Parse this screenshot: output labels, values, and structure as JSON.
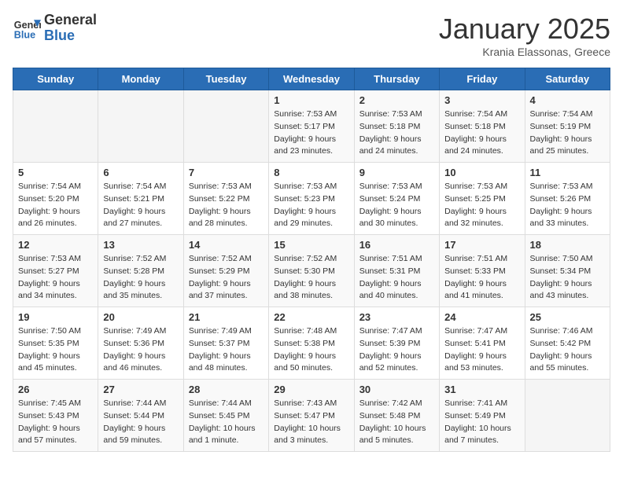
{
  "header": {
    "logo_general": "General",
    "logo_blue": "Blue",
    "month_title": "January 2025",
    "subtitle": "Krania Elassonas, Greece"
  },
  "weekdays": [
    "Sunday",
    "Monday",
    "Tuesday",
    "Wednesday",
    "Thursday",
    "Friday",
    "Saturday"
  ],
  "weeks": [
    [
      {
        "day": "",
        "sunrise": "",
        "sunset": "",
        "daylight": ""
      },
      {
        "day": "",
        "sunrise": "",
        "sunset": "",
        "daylight": ""
      },
      {
        "day": "",
        "sunrise": "",
        "sunset": "",
        "daylight": ""
      },
      {
        "day": "1",
        "sunrise": "Sunrise: 7:53 AM",
        "sunset": "Sunset: 5:17 PM",
        "daylight": "Daylight: 9 hours and 23 minutes."
      },
      {
        "day": "2",
        "sunrise": "Sunrise: 7:53 AM",
        "sunset": "Sunset: 5:18 PM",
        "daylight": "Daylight: 9 hours and 24 minutes."
      },
      {
        "day": "3",
        "sunrise": "Sunrise: 7:54 AM",
        "sunset": "Sunset: 5:18 PM",
        "daylight": "Daylight: 9 hours and 24 minutes."
      },
      {
        "day": "4",
        "sunrise": "Sunrise: 7:54 AM",
        "sunset": "Sunset: 5:19 PM",
        "daylight": "Daylight: 9 hours and 25 minutes."
      }
    ],
    [
      {
        "day": "5",
        "sunrise": "Sunrise: 7:54 AM",
        "sunset": "Sunset: 5:20 PM",
        "daylight": "Daylight: 9 hours and 26 minutes."
      },
      {
        "day": "6",
        "sunrise": "Sunrise: 7:54 AM",
        "sunset": "Sunset: 5:21 PM",
        "daylight": "Daylight: 9 hours and 27 minutes."
      },
      {
        "day": "7",
        "sunrise": "Sunrise: 7:53 AM",
        "sunset": "Sunset: 5:22 PM",
        "daylight": "Daylight: 9 hours and 28 minutes."
      },
      {
        "day": "8",
        "sunrise": "Sunrise: 7:53 AM",
        "sunset": "Sunset: 5:23 PM",
        "daylight": "Daylight: 9 hours and 29 minutes."
      },
      {
        "day": "9",
        "sunrise": "Sunrise: 7:53 AM",
        "sunset": "Sunset: 5:24 PM",
        "daylight": "Daylight: 9 hours and 30 minutes."
      },
      {
        "day": "10",
        "sunrise": "Sunrise: 7:53 AM",
        "sunset": "Sunset: 5:25 PM",
        "daylight": "Daylight: 9 hours and 32 minutes."
      },
      {
        "day": "11",
        "sunrise": "Sunrise: 7:53 AM",
        "sunset": "Sunset: 5:26 PM",
        "daylight": "Daylight: 9 hours and 33 minutes."
      }
    ],
    [
      {
        "day": "12",
        "sunrise": "Sunrise: 7:53 AM",
        "sunset": "Sunset: 5:27 PM",
        "daylight": "Daylight: 9 hours and 34 minutes."
      },
      {
        "day": "13",
        "sunrise": "Sunrise: 7:52 AM",
        "sunset": "Sunset: 5:28 PM",
        "daylight": "Daylight: 9 hours and 35 minutes."
      },
      {
        "day": "14",
        "sunrise": "Sunrise: 7:52 AM",
        "sunset": "Sunset: 5:29 PM",
        "daylight": "Daylight: 9 hours and 37 minutes."
      },
      {
        "day": "15",
        "sunrise": "Sunrise: 7:52 AM",
        "sunset": "Sunset: 5:30 PM",
        "daylight": "Daylight: 9 hours and 38 minutes."
      },
      {
        "day": "16",
        "sunrise": "Sunrise: 7:51 AM",
        "sunset": "Sunset: 5:31 PM",
        "daylight": "Daylight: 9 hours and 40 minutes."
      },
      {
        "day": "17",
        "sunrise": "Sunrise: 7:51 AM",
        "sunset": "Sunset: 5:33 PM",
        "daylight": "Daylight: 9 hours and 41 minutes."
      },
      {
        "day": "18",
        "sunrise": "Sunrise: 7:50 AM",
        "sunset": "Sunset: 5:34 PM",
        "daylight": "Daylight: 9 hours and 43 minutes."
      }
    ],
    [
      {
        "day": "19",
        "sunrise": "Sunrise: 7:50 AM",
        "sunset": "Sunset: 5:35 PM",
        "daylight": "Daylight: 9 hours and 45 minutes."
      },
      {
        "day": "20",
        "sunrise": "Sunrise: 7:49 AM",
        "sunset": "Sunset: 5:36 PM",
        "daylight": "Daylight: 9 hours and 46 minutes."
      },
      {
        "day": "21",
        "sunrise": "Sunrise: 7:49 AM",
        "sunset": "Sunset: 5:37 PM",
        "daylight": "Daylight: 9 hours and 48 minutes."
      },
      {
        "day": "22",
        "sunrise": "Sunrise: 7:48 AM",
        "sunset": "Sunset: 5:38 PM",
        "daylight": "Daylight: 9 hours and 50 minutes."
      },
      {
        "day": "23",
        "sunrise": "Sunrise: 7:47 AM",
        "sunset": "Sunset: 5:39 PM",
        "daylight": "Daylight: 9 hours and 52 minutes."
      },
      {
        "day": "24",
        "sunrise": "Sunrise: 7:47 AM",
        "sunset": "Sunset: 5:41 PM",
        "daylight": "Daylight: 9 hours and 53 minutes."
      },
      {
        "day": "25",
        "sunrise": "Sunrise: 7:46 AM",
        "sunset": "Sunset: 5:42 PM",
        "daylight": "Daylight: 9 hours and 55 minutes."
      }
    ],
    [
      {
        "day": "26",
        "sunrise": "Sunrise: 7:45 AM",
        "sunset": "Sunset: 5:43 PM",
        "daylight": "Daylight: 9 hours and 57 minutes."
      },
      {
        "day": "27",
        "sunrise": "Sunrise: 7:44 AM",
        "sunset": "Sunset: 5:44 PM",
        "daylight": "Daylight: 9 hours and 59 minutes."
      },
      {
        "day": "28",
        "sunrise": "Sunrise: 7:44 AM",
        "sunset": "Sunset: 5:45 PM",
        "daylight": "Daylight: 10 hours and 1 minute."
      },
      {
        "day": "29",
        "sunrise": "Sunrise: 7:43 AM",
        "sunset": "Sunset: 5:47 PM",
        "daylight": "Daylight: 10 hours and 3 minutes."
      },
      {
        "day": "30",
        "sunrise": "Sunrise: 7:42 AM",
        "sunset": "Sunset: 5:48 PM",
        "daylight": "Daylight: 10 hours and 5 minutes."
      },
      {
        "day": "31",
        "sunrise": "Sunrise: 7:41 AM",
        "sunset": "Sunset: 5:49 PM",
        "daylight": "Daylight: 10 hours and 7 minutes."
      },
      {
        "day": "",
        "sunrise": "",
        "sunset": "",
        "daylight": ""
      }
    ]
  ]
}
